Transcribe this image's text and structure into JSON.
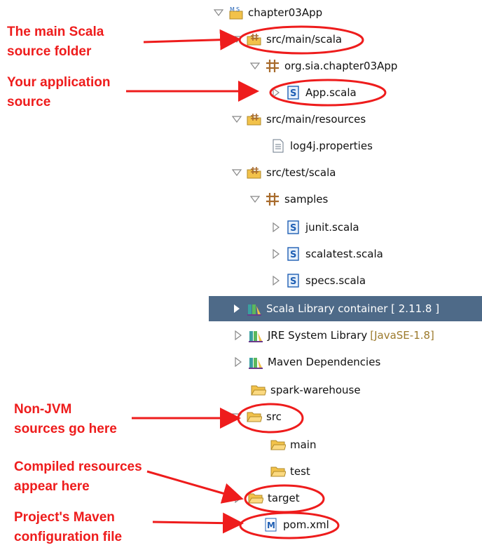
{
  "tree": {
    "project": "chapter03App",
    "src_main_scala": "src/main/scala",
    "package_main": "org.sia.chapter03App",
    "app_scala": "App.scala",
    "src_main_resources": "src/main/resources",
    "log4j": "log4j.properties",
    "src_test_scala": "src/test/scala",
    "samples": "samples",
    "junit": "junit.scala",
    "scalatest": "scalatest.scala",
    "specs": "specs.scala",
    "scala_library": "Scala Library container [ 2.11.8 ]",
    "jre_library": "JRE System Library",
    "jre_decoration": "[JavaSE-1.8]",
    "maven_deps": "Maven Dependencies",
    "spark_warehouse": "spark-warehouse",
    "src": "src",
    "main": "main",
    "test": "test",
    "target": "target",
    "pom": "pom.xml"
  },
  "annotations": {
    "main_scala_line1": "The main Scala",
    "main_scala_line2": "source folder",
    "app_source_line1": "Your application",
    "app_source_line2": "source",
    "non_jvm_line1": "Non-JVM",
    "non_jvm_line2": "sources go here",
    "compiled_line1": "Compiled resources",
    "compiled_line2": "appear here",
    "maven_config_line1": "Project's Maven",
    "maven_config_line2": "configuration file"
  },
  "colors": {
    "annotation_red": "#ee1c1c",
    "selection_blue": "#4e6a88",
    "folder_yellow": "#f2c24a",
    "package_brown": "#a86b2c",
    "scala_blue": "#1f5fb4"
  }
}
